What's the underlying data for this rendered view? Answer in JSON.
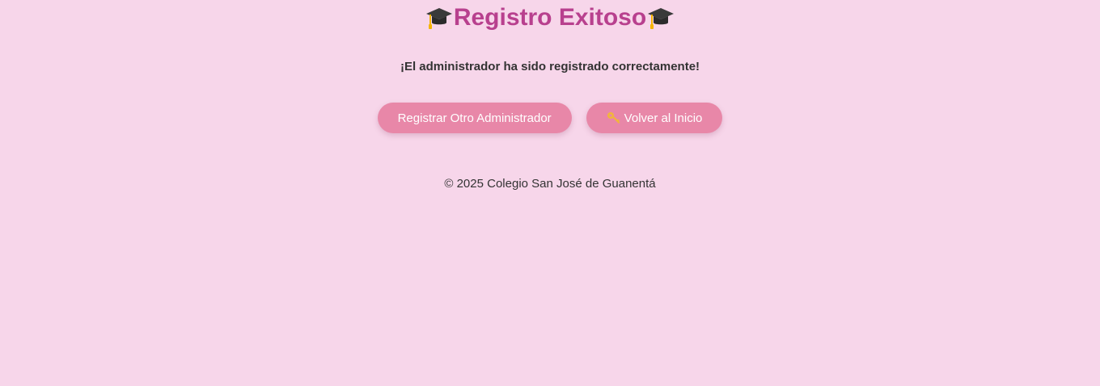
{
  "header": {
    "title": "Registro Exitoso",
    "title_color": "#b8408e",
    "left_icon": "graduation-cap-icon",
    "right_icon": "graduation-cap-icon"
  },
  "main": {
    "message": "¡El administrador ha sido registrado correctamente!"
  },
  "actions": {
    "register_another_label": "Registrar Otro Administrador",
    "back_home_label": "Volver al Inicio",
    "back_home_icon": "key-icon",
    "button_color": "#e887a8"
  },
  "footer": {
    "copyright": "© 2025 Colegio San José de Guanentá"
  },
  "colors": {
    "background": "#f7d6ea",
    "text": "#333333"
  }
}
